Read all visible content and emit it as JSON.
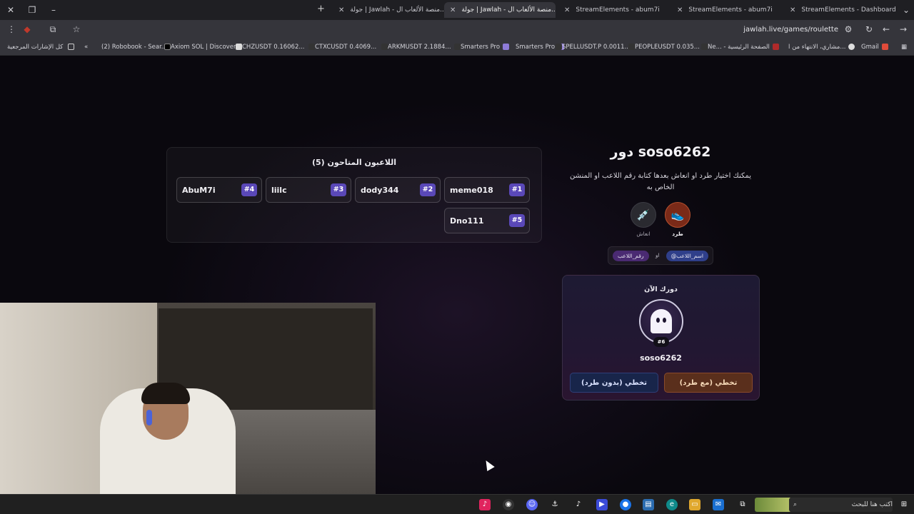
{
  "browser": {
    "tabs": [
      {
        "label": "جولة | Jawlah - منصة الألعاب ال...",
        "active": false
      },
      {
        "label": "جولة | Jawlah - منصة الألعاب ال...",
        "active": true
      },
      {
        "label": "StreamElements - abum7i",
        "active": false
      },
      {
        "label": "StreamElements - abum7i",
        "active": false
      },
      {
        "label": "StreamElements - Dashboard",
        "active": false
      }
    ],
    "url": "jawlah.live/games/roulette",
    "bookmarks": [
      "(2) Robobook - Sear...",
      "Axiom SOL | Discover",
      "CHZUSDT 0.16062...",
      "CTXCUSDT 0.4069...",
      "ARKMUSDT 2.1884...",
      "Smarters Pro",
      "Smarters Pro",
      "SPELLUSDT.P 0.0011...",
      "PEOPLEUSDT 0.035...",
      "Ne... - الصفحة الرئيسية",
      "مشاري، الانتهاء من ا...",
      "Gmail"
    ],
    "bookmarks_folder": "كل الإشارات المرجعية"
  },
  "players": {
    "title": "اللاعبون المتاحون (5)",
    "list": [
      {
        "name": "meme018",
        "num": "#1"
      },
      {
        "name": "dody344",
        "num": "#2"
      },
      {
        "name": "liilc",
        "num": "#3"
      },
      {
        "name": "AbuM7i",
        "num": "#4"
      },
      {
        "name": "Dno111",
        "num": "#5"
      }
    ]
  },
  "turn": {
    "title": "دور soso6262",
    "description": "يمكنك اختيار طرد او انعاش بعدها كتابة رقم اللاعب او المنشن الخاص به",
    "actions": [
      {
        "label": "طرد",
        "icon": "kick-icon",
        "color": "#7a2a18"
      },
      {
        "label": "انعاش",
        "icon": "syringe-icon",
        "color": "#2a2a30"
      }
    ],
    "hint_name": "@اسم_اللاعب",
    "hint_or": "او",
    "hint_number": "رقم_اللاعب"
  },
  "current": {
    "label": "دورك الآن",
    "avatar_badge": "#6",
    "name": "soso6262",
    "btn_kick": "تخطي (مع طرد)",
    "btn_no_kick": "تخطي (بدون طرد)"
  },
  "taskbar": {
    "search_placeholder": "اكتب هنا للبحث"
  },
  "colors": {
    "accent_purple": "#5a48b8",
    "kick_button": "#5a2f1c",
    "nokick_button": "#18254a"
  }
}
